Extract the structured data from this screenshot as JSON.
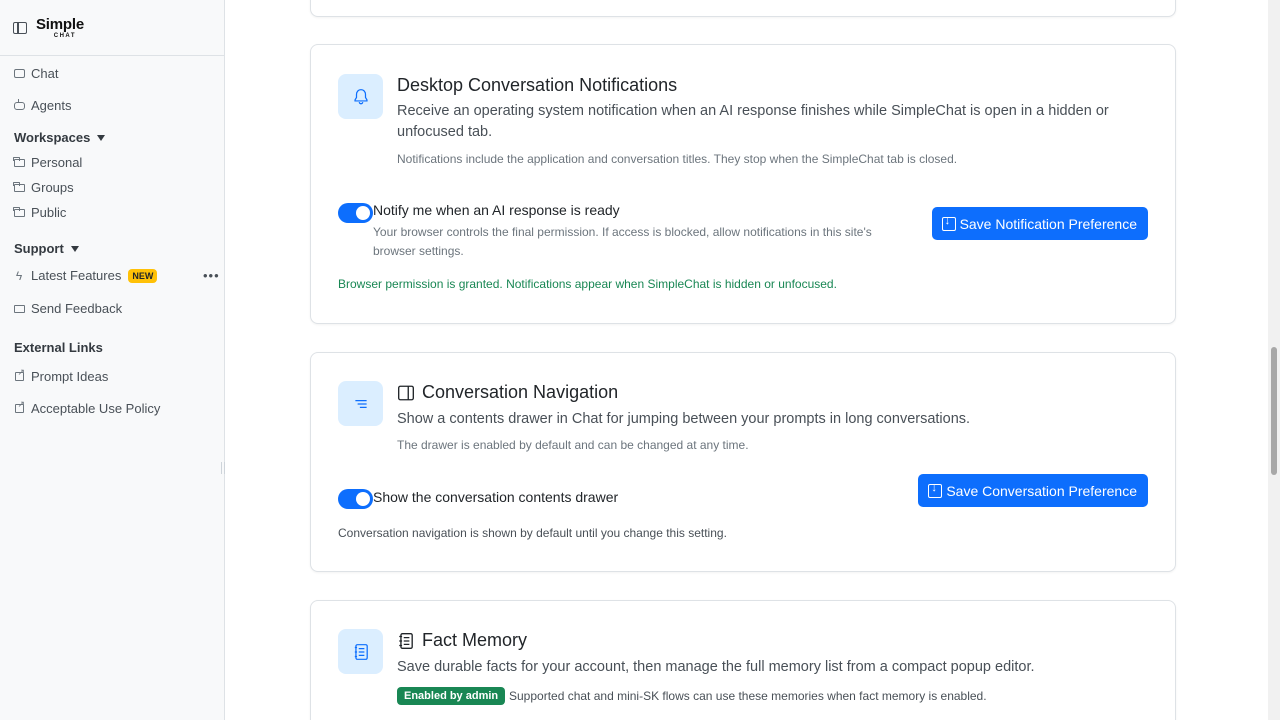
{
  "brand": {
    "name": "Simple",
    "sub": "CHAT"
  },
  "sidebar": {
    "chat": "Chat",
    "agents": "Agents",
    "workspaces": "Workspaces",
    "personal": "Personal",
    "groups": "Groups",
    "public": "Public",
    "support": "Support",
    "latest_features": "Latest Features",
    "new_badge": "NEW",
    "more": "•••",
    "send_feedback": "Send Feedback",
    "external_links": "External Links",
    "prompt_ideas": "Prompt Ideas",
    "acceptable_use": "Acceptable Use Policy"
  },
  "notifications": {
    "title": "Desktop Conversation Notifications",
    "desc": "Receive an operating system notification when an AI response finishes while SimpleChat is open in a hidden or unfocused tab.",
    "note": "Notifications include the application and conversation titles. They stop when the SimpleChat tab is closed.",
    "toggle_label": "Notify me when an AI response is ready",
    "toggle_on": true,
    "help": "Your browser controls the final permission. If access is blocked, allow notifications in this site's browser settings.",
    "button": "Save Notification Preference",
    "status": "Browser permission is granted. Notifications appear when SimpleChat is hidden or unfocused."
  },
  "navigation": {
    "title": "Conversation Navigation",
    "desc": "Show a contents drawer in Chat for jumping between your prompts in long conversations.",
    "note": "The drawer is enabled by default and can be changed at any time.",
    "toggle_label": "Show the conversation contents drawer",
    "toggle_on": true,
    "button": "Save Conversation Preference",
    "status": "Conversation navigation is shown by default until you change this setting."
  },
  "memory": {
    "title": "Fact Memory",
    "desc": "Save durable facts for your account, then manage the full memory list from a compact popup editor.",
    "badge": "Enabled by admin",
    "note": "Supported chat and mini-SK flows can use these memories when fact memory is enabled."
  },
  "colors": {
    "primary": "#0d6efd",
    "success": "#198754",
    "warning": "#ffc107",
    "tile": "#dbeeff"
  }
}
